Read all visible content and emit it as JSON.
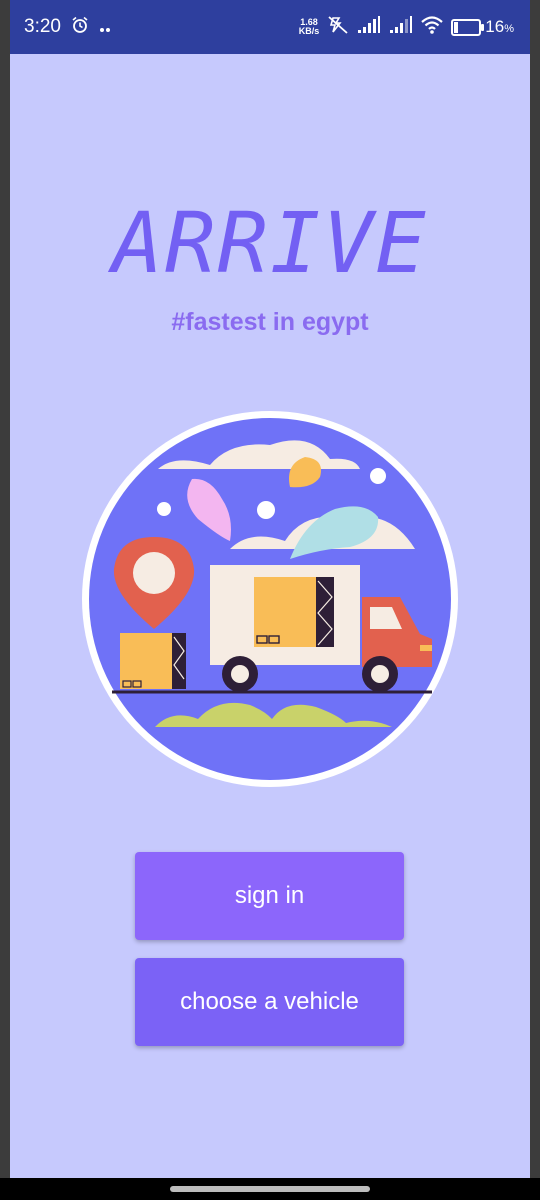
{
  "status_bar": {
    "time": "3:20",
    "net_speed_value": "1.68",
    "net_speed_unit": "KB/s",
    "battery_percent": "16",
    "battery_unit": "%",
    "icons": [
      "alarm-icon",
      "notification-dots-icon",
      "mute-icon",
      "signal-icon",
      "signal-icon",
      "wifi-icon",
      "battery-icon"
    ]
  },
  "app": {
    "title": "ARRIVE",
    "tagline": "#fastest in egypt"
  },
  "buttons": {
    "sign_in": "sign in",
    "choose_vehicle": "choose a vehicle"
  },
  "colors": {
    "background": "#c6c9fd",
    "accent": "#7360f3",
    "button_primary": "#8c66fb",
    "button_secondary": "#7b62f6",
    "status_bar": "#2e3f9e"
  },
  "illustration": "delivery-truck-illustration"
}
